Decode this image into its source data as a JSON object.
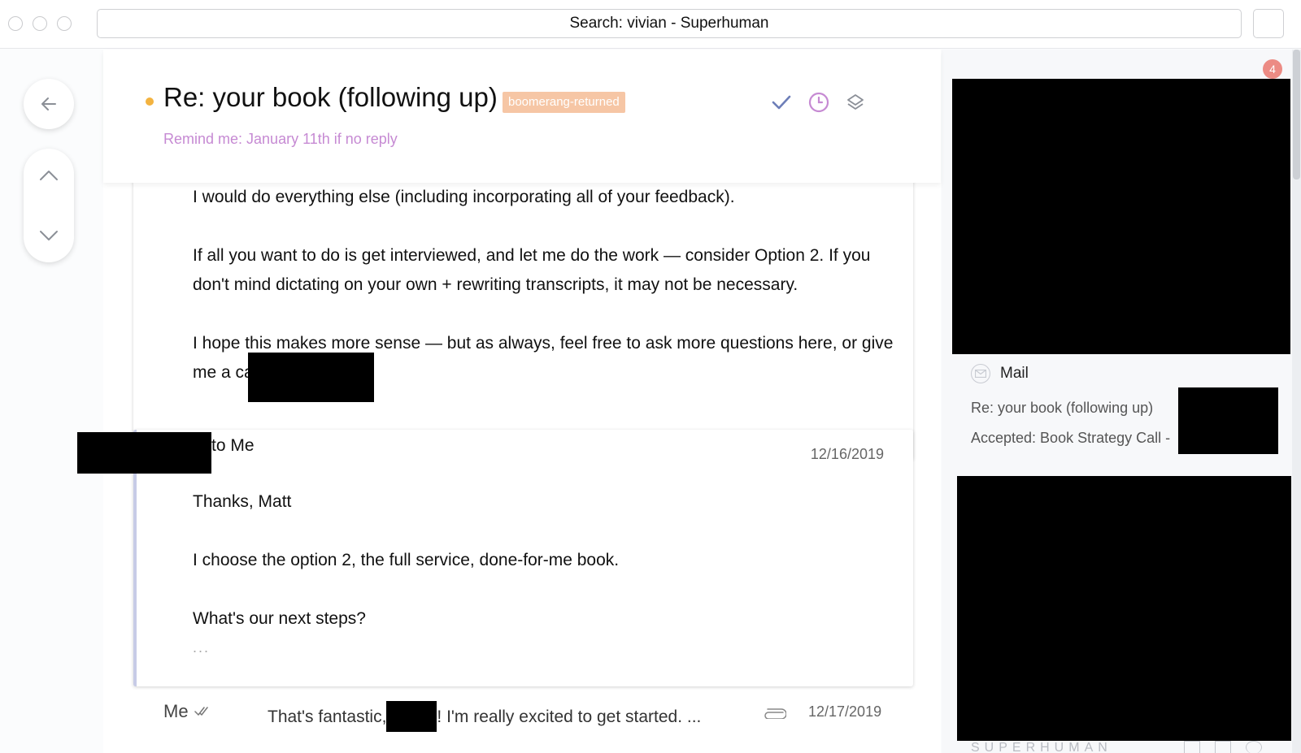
{
  "window": {
    "title": "Search: vivian - Superhuman"
  },
  "thread": {
    "subject": "Re: your book (following up)",
    "label": "boomerang-returned",
    "reminder": "Remind me: January 11th if no reply"
  },
  "message1": {
    "lines": [
      "I would do everything else (including incorporating all of your feedback).",
      "If all you want to do is get interviewed, and let me do the work  — consider Option 2. If you",
      "don't mind dictating on your own + rewriting transcripts, it may not be necessary.",
      "I hope this makes more sense — but as always, feel free to ask more questions here, or give",
      "me a call (8"
    ]
  },
  "message2": {
    "to": "to Me",
    "date": "12/16/2019",
    "lines": [
      "Thanks, Matt",
      "I choose the option 2, the full service, done-for-me book.",
      "What's our next steps?"
    ],
    "ellipsis": "..."
  },
  "message3": {
    "sender": "Me",
    "snippet_start": "That's fantastic,",
    "snippet_end": "! I'm really excited to get started. ...",
    "date": "12/17/2019"
  },
  "sidebar": {
    "badge_count": "4",
    "section_title": "Mail",
    "items": [
      "Re: your book (following up)",
      "Accepted: Book Strategy Call -"
    ],
    "footer_brand": "SUPERHUMAN"
  },
  "icons": {
    "back": "arrow-left-icon",
    "prev": "chevron-up-icon",
    "next": "chevron-down-icon",
    "done": "checkmark-icon",
    "remind": "clock-icon",
    "label": "layers-icon",
    "mail": "mail-icon",
    "attachment": "paperclip-icon"
  },
  "colors": {
    "unread_dot": "#f3b340",
    "label_badge": "#f6c6a5",
    "reminder_text": "#c68ad3",
    "quote_border": "#c7cbe6",
    "count_badge": "#ec8b84"
  }
}
